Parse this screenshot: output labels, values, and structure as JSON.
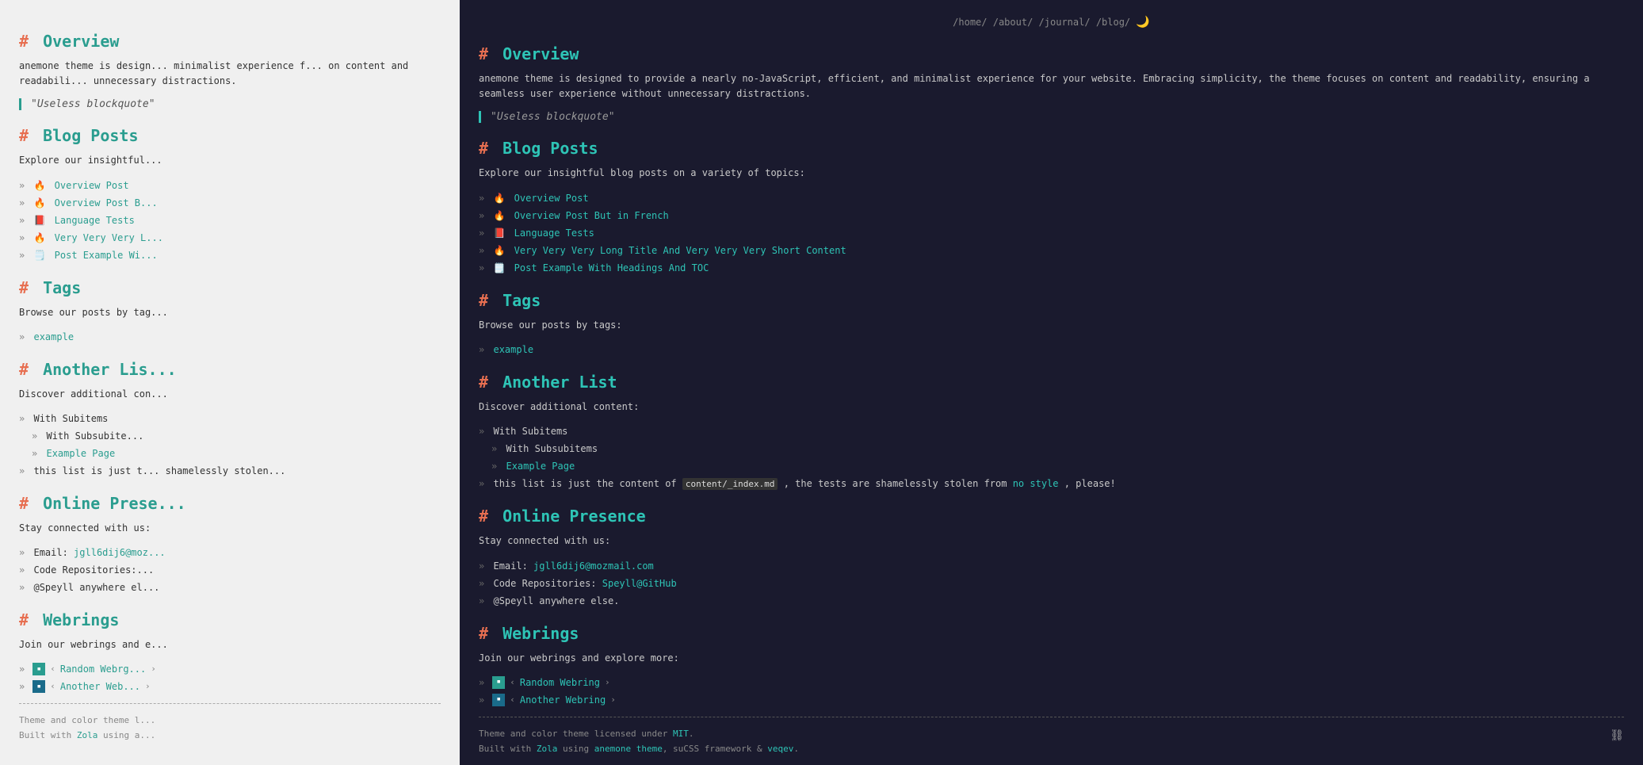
{
  "nav": {
    "links": [
      "/home/",
      "/about/",
      "/journal/",
      "/blog/"
    ],
    "separator": "/"
  },
  "overview": {
    "heading_hash": "#",
    "heading": "Overview",
    "body": "anemone theme is designed to provide a nearly no-JavaScript, efficient, and minimalist experience for your website. Embracing simplicity, the theme focuses on content and readability, ensuring a seamless user experience without unnecessary distractions.",
    "blockquote": "\"Useless blockquote\""
  },
  "blog_posts": {
    "heading_hash": "#",
    "heading": "Blog Posts",
    "intro": "Explore our insightful blog posts on a variety of topics:",
    "items": [
      {
        "emoji": "🔥",
        "label": "Overview Post",
        "href": "#"
      },
      {
        "emoji": "🔥",
        "label": "Overview Post But in French",
        "href": "#"
      },
      {
        "emoji": "📕",
        "label": "Language Tests",
        "href": "#"
      },
      {
        "emoji": "🔥",
        "label": "Very Very Very Long Title And Very Very Very Short Content",
        "href": "#"
      },
      {
        "emoji": "🗒️",
        "label": "Post Example With Headings And TOC",
        "href": "#"
      }
    ]
  },
  "tags": {
    "heading_hash": "#",
    "heading": "Tags",
    "intro": "Browse our posts by tags:",
    "items": [
      {
        "label": "example",
        "href": "#"
      }
    ]
  },
  "another_list": {
    "heading_hash": "#",
    "heading": "Another List",
    "intro": "Discover additional content:",
    "items": [
      {
        "label": "With Subitems",
        "subitems": [
          {
            "label": "With Subsubitems",
            "subitems": []
          },
          {
            "label": "Example Page",
            "subitems": []
          }
        ]
      },
      {
        "label_prefix": "this list is just the content of",
        "code": "content/_index.md",
        "label_suffix": ", the tests are shamelessly stolen from",
        "link": "no style",
        "link_suffix": ", please!"
      }
    ]
  },
  "online_presence": {
    "heading_hash": "#",
    "heading": "Online Presence",
    "intro": "Stay connected with us:",
    "items": [
      {
        "label": "Email: ",
        "link": "jgll6dij6@mozmail.com",
        "href": "#"
      },
      {
        "label": "Code Repositories: ",
        "link": "Speyll@GitHub",
        "href": "#"
      },
      {
        "label": "@Speyll anywhere else.",
        "href": null
      }
    ]
  },
  "webrings": {
    "heading_hash": "#",
    "heading": "Webrings",
    "intro": "Join our webrings and explore more:",
    "items": [
      {
        "icon": "green",
        "label": "Random Webring",
        "has_nav": true
      },
      {
        "icon": "teal",
        "label": "Another Webring",
        "has_nav": true
      }
    ]
  },
  "footer": {
    "license_text": "Theme and color theme licensed under",
    "license_link": "MIT",
    "built_text": "Built with",
    "zola_link": "Zola",
    "using_text": "using",
    "anemone_link": "anemone theme",
    "framework_text": ", suCSS framework &",
    "veqev_link": "veqev",
    "period": "."
  },
  "left_truncated": {
    "overview_body": "anemone theme is design... minimalist experience f... on content and readabili... unnecessary distractions.",
    "blockquote": "\"Useless blockquote...",
    "blog_intro": "Explore our insightful...",
    "another_list_intro": "Discover additional con...",
    "another_list_body": "this list is just t... shamelessly stolen..."
  }
}
